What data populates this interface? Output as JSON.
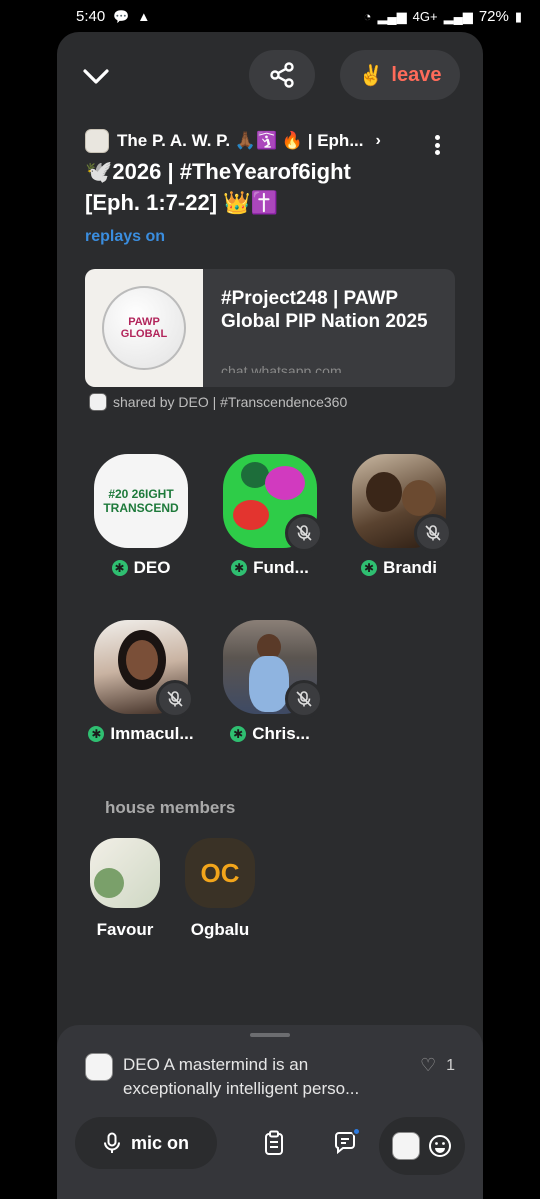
{
  "status_bar": {
    "time": "5:40",
    "network": "4G+",
    "battery": "72%"
  },
  "header": {
    "leave_label": "leave",
    "club_name": "The P. A. W. P. 🙏🏾🛐 🔥 | Eph...",
    "room_title_line1": "🕊️2026 | #TheYearof6ight",
    "room_title_line2": "[Eph. 1:7-22] 👑✝️",
    "replays": "replays on"
  },
  "link_card": {
    "thumb_text": "PAWP GLOBAL",
    "title": "#Project248 | PAWP Global PIP Nation 2025",
    "url": "chat.whatsapp.com"
  },
  "shared_by": "shared by DEO | #Transcendence360",
  "speakers": [
    {
      "name": "DEO",
      "avatar_text": "#20 26IGHT TRANSCEND"
    },
    {
      "name": "Fund..."
    },
    {
      "name": "Brandi"
    },
    {
      "name": "Immacul..."
    },
    {
      "name": "Chris..."
    }
  ],
  "house_members_label": "house members",
  "members": [
    {
      "name": "Favour"
    },
    {
      "name": "Ogbalu",
      "initials": "OC"
    }
  ],
  "chat": {
    "author": "DEO",
    "text": " A mastermind is an exceptionally intelligent perso...",
    "likes": "1"
  },
  "mic_label": "mic on",
  "colors": {
    "panel": "#2b2c2e",
    "accent_leave": "#ff6b5a",
    "link_blue": "#3a8dde",
    "speaker_green": "#2fbf71",
    "oc_orange": "#f2a51b"
  }
}
